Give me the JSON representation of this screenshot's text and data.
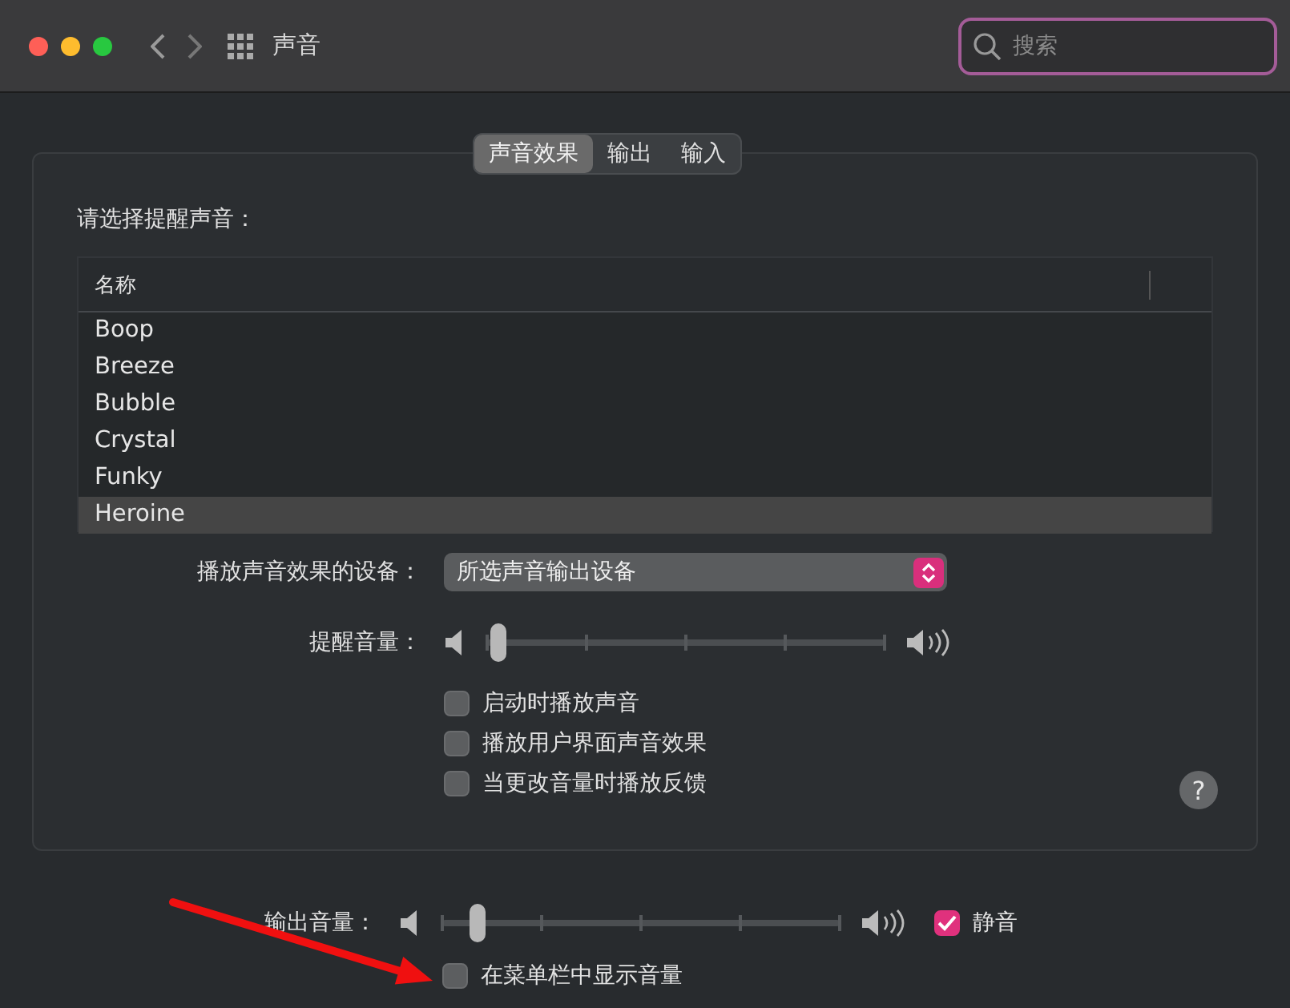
{
  "window": {
    "title": "声音"
  },
  "search": {
    "placeholder": "搜索"
  },
  "tabs": [
    {
      "label": "声音效果",
      "selected": true
    },
    {
      "label": "输出",
      "selected": false
    },
    {
      "label": "输入",
      "selected": false
    }
  ],
  "alert_sound_label": "请选择提醒声音：",
  "sound_list": {
    "column": "名称",
    "items": [
      {
        "name": "Boop",
        "selected": false
      },
      {
        "name": "Breeze",
        "selected": false
      },
      {
        "name": "Bubble",
        "selected": false
      },
      {
        "name": "Crystal",
        "selected": false
      },
      {
        "name": "Funky",
        "selected": false
      },
      {
        "name": "Heroine",
        "selected": true
      }
    ]
  },
  "device": {
    "label": "播放声音效果的设备：",
    "value": "所选声音输出设备"
  },
  "alert_volume": {
    "label": "提醒音量：",
    "level": 0.03
  },
  "options": [
    {
      "label": "启动时播放声音",
      "checked": false
    },
    {
      "label": "播放用户界面声音效果",
      "checked": false
    },
    {
      "label": "当更改音量时播放反馈",
      "checked": false
    }
  ],
  "help": "?",
  "output_volume": {
    "label": "输出音量：",
    "level": 0.09
  },
  "mute": {
    "label": "静音",
    "checked": true
  },
  "menu_bar_option": {
    "label": "在菜单栏中显示音量",
    "checked": false
  }
}
